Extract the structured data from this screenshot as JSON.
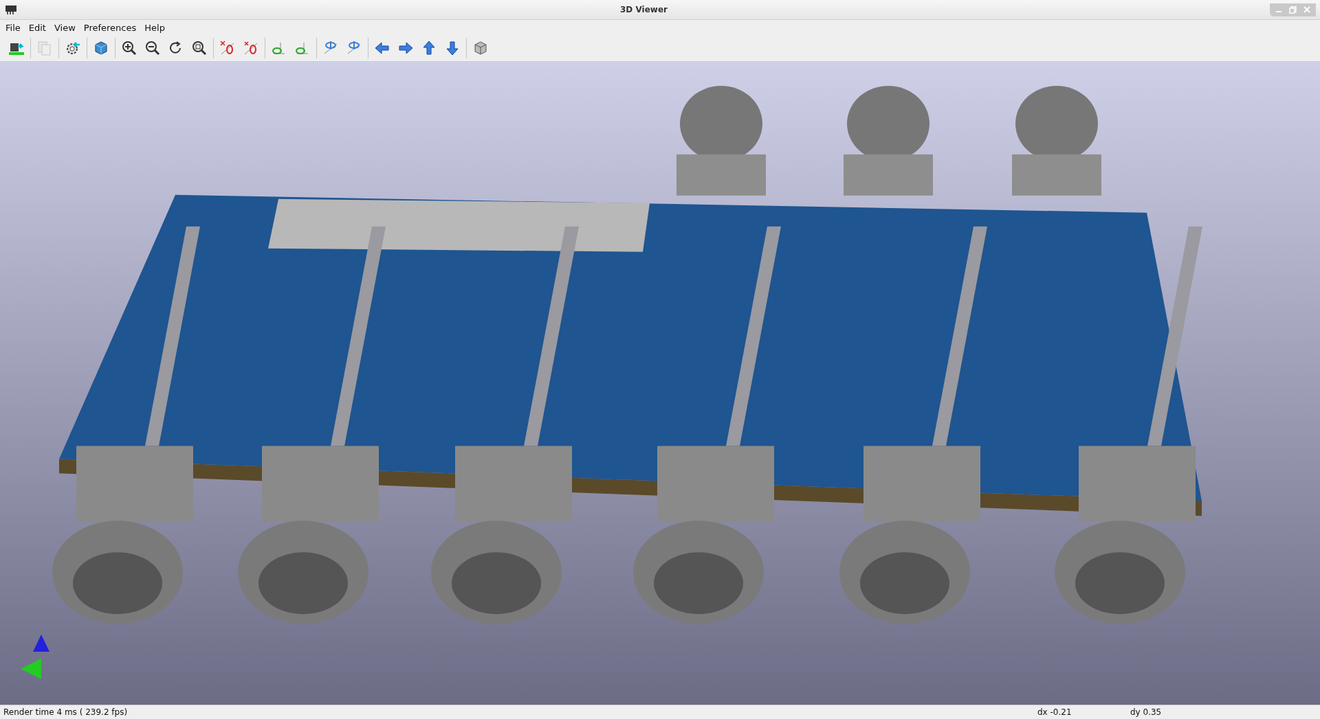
{
  "window": {
    "title": "3D Viewer"
  },
  "menu": [
    "File",
    "Edit",
    "View",
    "Preferences",
    "Help"
  ],
  "toolbar": {
    "groups": [
      [
        {
          "kind": "reload",
          "disabled": false
        }
      ],
      [
        {
          "kind": "copy",
          "disabled": true
        }
      ],
      [
        {
          "kind": "settings",
          "disabled": false
        }
      ],
      [
        {
          "kind": "raytrace",
          "disabled": false
        }
      ],
      [
        {
          "kind": "zoom-in",
          "disabled": false
        },
        {
          "kind": "zoom-out",
          "disabled": false
        },
        {
          "kind": "redraw",
          "disabled": false
        },
        {
          "kind": "zoom-fit",
          "disabled": false
        }
      ],
      [
        {
          "kind": "rotate-x-left",
          "disabled": false
        },
        {
          "kind": "rotate-x-right",
          "disabled": false
        }
      ],
      [
        {
          "kind": "rotate-y-left",
          "disabled": false
        },
        {
          "kind": "rotate-y-right",
          "disabled": false
        }
      ],
      [
        {
          "kind": "rotate-z-left",
          "disabled": false
        },
        {
          "kind": "rotate-z-right",
          "disabled": false
        }
      ],
      [
        {
          "kind": "move-left",
          "disabled": false
        },
        {
          "kind": "move-right",
          "disabled": false
        },
        {
          "kind": "move-up",
          "disabled": false
        },
        {
          "kind": "move-down",
          "disabled": false
        }
      ],
      [
        {
          "kind": "ortho",
          "disabled": false
        }
      ]
    ]
  },
  "status_bar": {
    "render_time": "Render time 4 ms ( 239.2 fps)",
    "dx": "dx -0.21",
    "dy": "dy 0.35"
  }
}
